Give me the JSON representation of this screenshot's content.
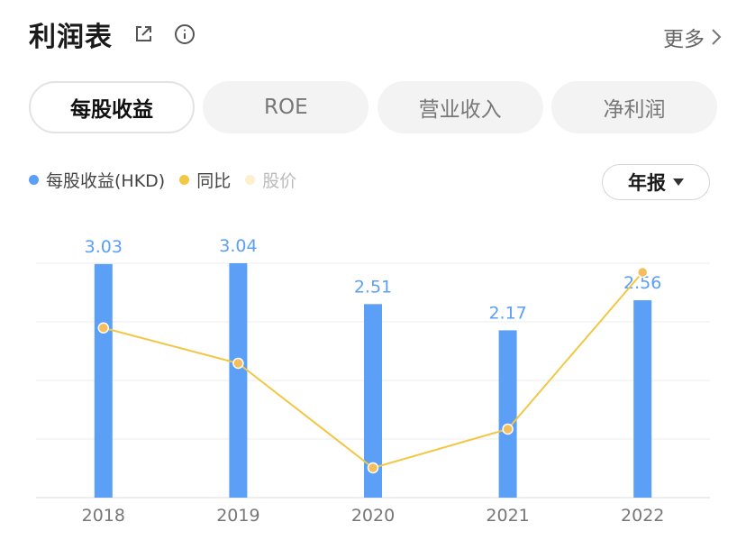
{
  "header": {
    "title": "利润表",
    "more_label": "更多"
  },
  "tabs": [
    {
      "label": "每股收益",
      "active": true
    },
    {
      "label": "ROE",
      "active": false
    },
    {
      "label": "营业收入",
      "active": false
    },
    {
      "label": "净利润",
      "active": false
    }
  ],
  "legend": [
    {
      "label": "每股收益(HKD)",
      "color": "#5b9ff6"
    },
    {
      "label": "同比",
      "color": "#f2c744"
    },
    {
      "label": "股价",
      "color": "#fdf0cc"
    }
  ],
  "period": {
    "label": "年报"
  },
  "chart_data": {
    "type": "bar",
    "categories": [
      "2018",
      "2019",
      "2020",
      "2021",
      "2022"
    ],
    "series": [
      {
        "name": "每股收益(HKD)",
        "type": "bar",
        "color": "#5b9ff6",
        "values": [
          3.03,
          3.04,
          2.51,
          2.17,
          2.56
        ],
        "labels": [
          "3.03",
          "3.04",
          "2.51",
          "2.17",
          "2.56"
        ]
      },
      {
        "name": "同比",
        "type": "line",
        "color": "#f2c744",
        "values": [
          0.66,
          0.45,
          -0.17,
          0.06,
          0.99
        ]
      }
    ],
    "ylim": [
      0,
      3.04
    ],
    "grid": true,
    "legend_position": "top-left"
  }
}
